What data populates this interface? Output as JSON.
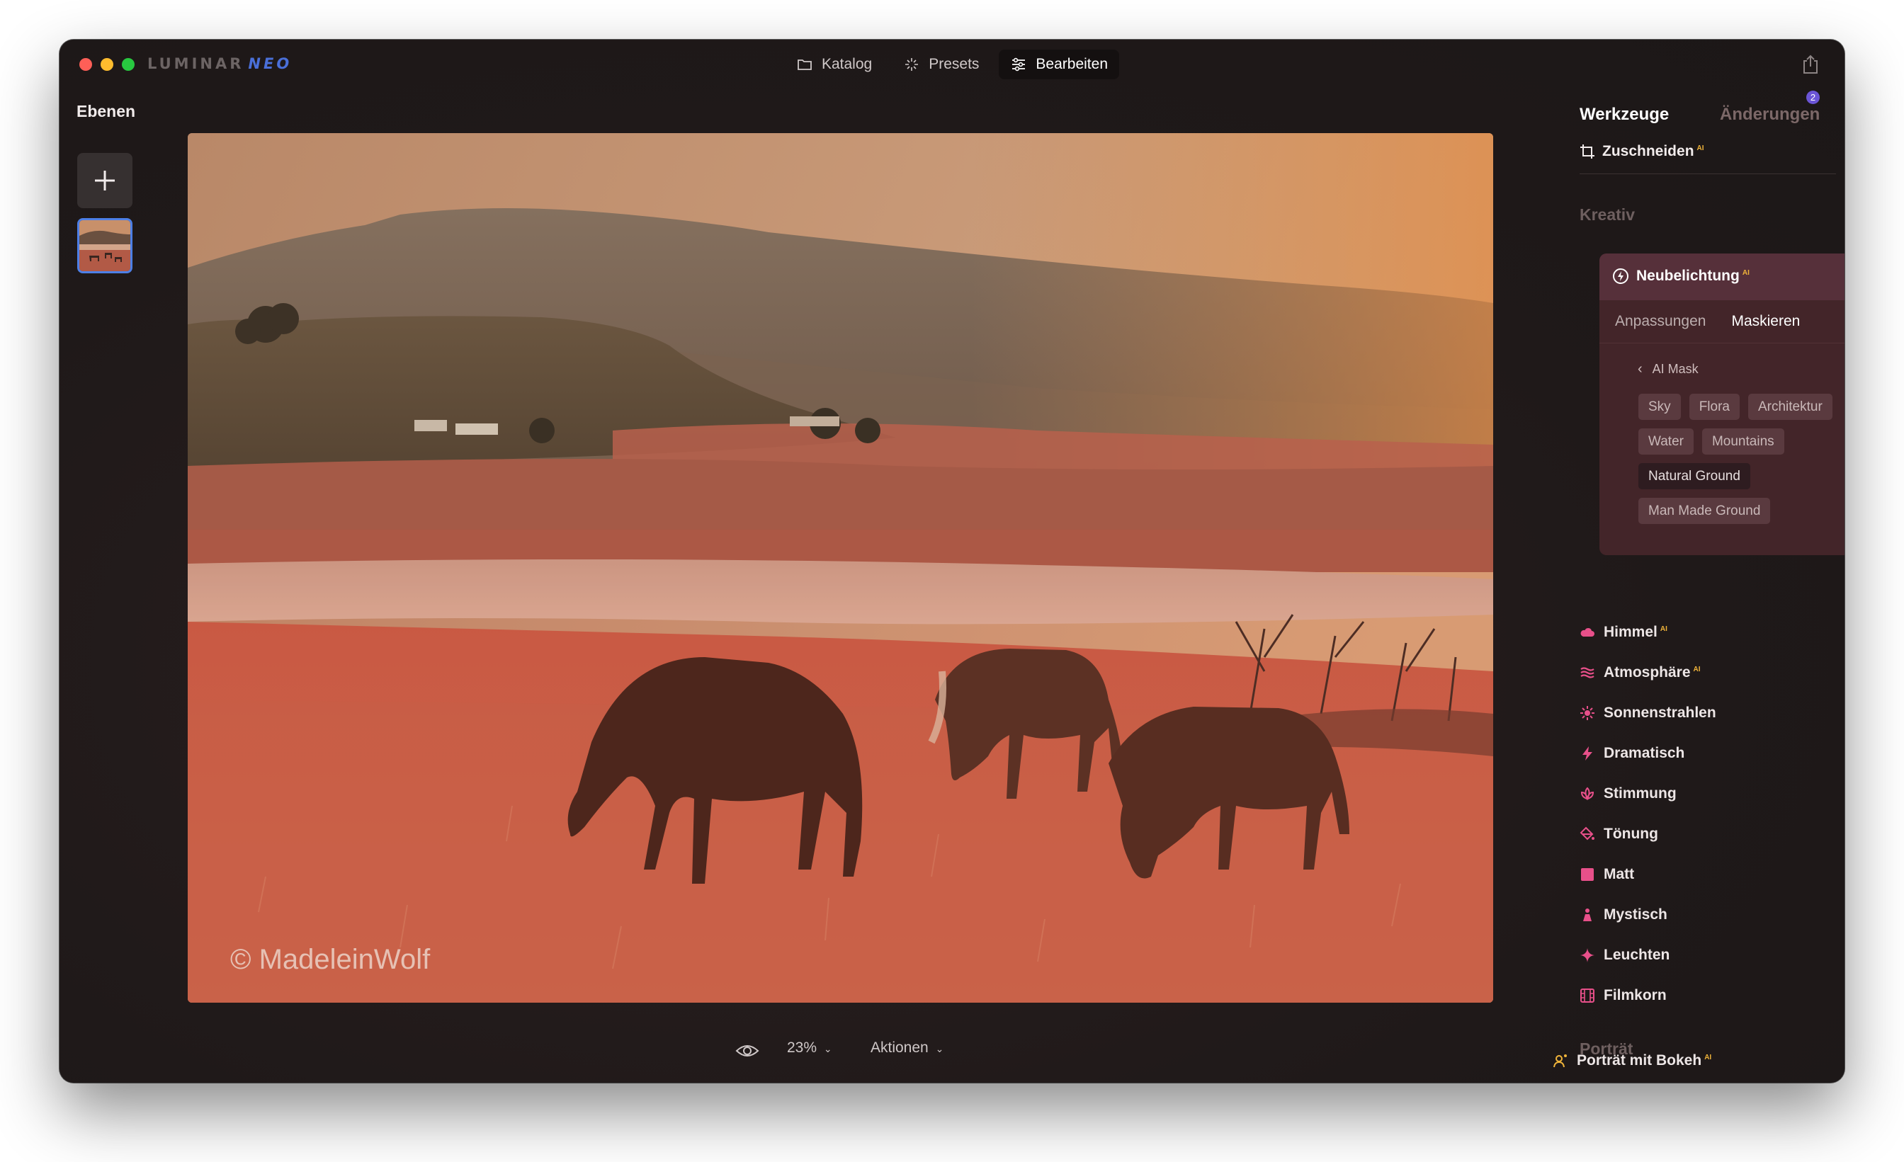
{
  "app": {
    "logo_main": "LUMINAR",
    "logo_accent": "NEO"
  },
  "nav": {
    "items": [
      {
        "label": "Katalog",
        "icon": "folder-icon"
      },
      {
        "label": "Presets",
        "icon": "sparkle-icon"
      },
      {
        "label": "Bearbeiten",
        "icon": "sliders-icon",
        "active": true
      }
    ]
  },
  "left": {
    "title": "Ebenen"
  },
  "photo": {
    "watermark": "© MadeleinWolf"
  },
  "bottom": {
    "zoom": "23%",
    "aktionen": "Aktionen"
  },
  "right": {
    "tab_tools": "Werkzeuge",
    "tab_changes": "Änderungen",
    "changes_badge": "2",
    "crop": "Zuschneiden",
    "ai_tag": "AI",
    "section_creative": "Kreativ",
    "section_portrait": "Porträt",
    "relight": {
      "title": "Neubelichtung",
      "tab_adjust": "Anpassungen",
      "tab_mask": "Maskieren",
      "ai_mask": "AI Mask",
      "chips": [
        [
          "Sky",
          "Flora",
          "Architektur"
        ],
        [
          "Water",
          "Mountains"
        ],
        [
          "Natural Ground"
        ],
        [
          "Man Made Ground"
        ]
      ],
      "selected_chip": "Natural Ground"
    },
    "tools": [
      {
        "label": "Himmel",
        "ai": true,
        "icon": "cloud-icon"
      },
      {
        "label": "Atmosphäre",
        "ai": true,
        "icon": "haze-icon"
      },
      {
        "label": "Sonnenstrahlen",
        "ai": false,
        "icon": "sun-icon"
      },
      {
        "label": "Dramatisch",
        "ai": false,
        "icon": "lightning-icon"
      },
      {
        "label": "Stimmung",
        "ai": false,
        "icon": "lotus-icon"
      },
      {
        "label": "Tönung",
        "ai": false,
        "icon": "paint-bucket-icon"
      },
      {
        "label": "Matt",
        "ai": false,
        "icon": "square-icon"
      },
      {
        "label": "Mystisch",
        "ai": false,
        "icon": "figure-icon"
      },
      {
        "label": "Leuchten",
        "ai": false,
        "icon": "star-icon"
      },
      {
        "label": "Filmkorn",
        "ai": false,
        "icon": "film-icon"
      }
    ],
    "portrait_tool": "Porträt mit Bokeh"
  },
  "colors": {
    "accent_pink": "#e8508a",
    "ai_gold": "#f0b43a",
    "card_bg": "#432529",
    "selection_blue": "#4d7fe6"
  }
}
